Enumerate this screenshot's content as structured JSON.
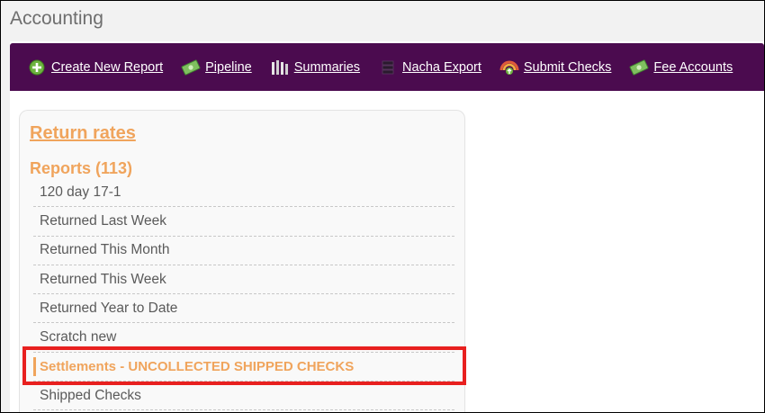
{
  "page": {
    "title": "Accounting"
  },
  "toolbar": {
    "items": [
      {
        "label": "Create New Report",
        "icon": "plus-circle-icon"
      },
      {
        "label": "Pipeline",
        "icon": "money-icon"
      },
      {
        "label": "Summaries",
        "icon": "columns-icon"
      },
      {
        "label": "Nacha Export",
        "icon": "database-icon"
      },
      {
        "label": "Submit Checks",
        "icon": "submit-icon"
      },
      {
        "label": "Fee Accounts",
        "icon": "money-icon"
      }
    ]
  },
  "sidebar": {
    "return_rates": "Return rates",
    "reports_heading": "Reports (113)",
    "reports": [
      {
        "label": "120 day 17-1"
      },
      {
        "label": "Returned Last Week"
      },
      {
        "label": "Returned This Month"
      },
      {
        "label": "Returned This Week"
      },
      {
        "label": "Returned Year to Date"
      },
      {
        "label": "Scratch new"
      },
      {
        "label": "Settlements - UNCOLLECTED SHIPPED CHECKS",
        "selected": true
      },
      {
        "label": "Shipped Checks"
      }
    ]
  },
  "colors": {
    "toolbar_bg": "#4b0b4f",
    "accent_orange": "#f0a45c",
    "highlight_red": "#e8201f"
  }
}
